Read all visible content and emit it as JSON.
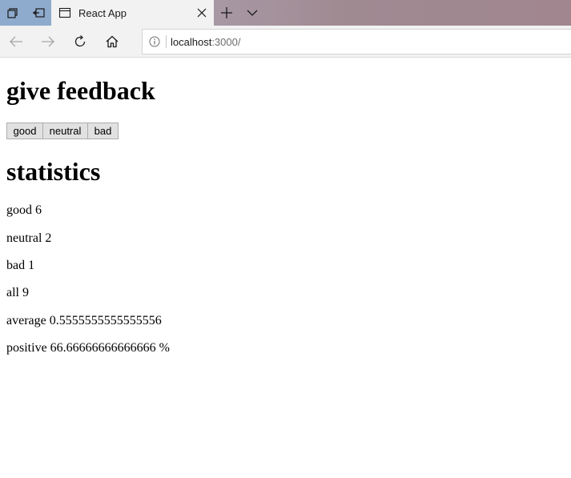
{
  "browser": {
    "tab": {
      "title": "React App"
    },
    "address": {
      "host": "localhost",
      "path": ":3000/"
    },
    "colors": {
      "tab_strip": "#a89aa6",
      "corner_buttons": "#8eaacc",
      "chrome": "#f2f2f2"
    }
  },
  "icons": {
    "tab_actions": "tab-actions-icon",
    "set_aside": "set-aside-tabs-icon",
    "page": "page-icon",
    "close": "close-icon",
    "new_tab": "plus-icon",
    "tab_list": "chevron-down-icon",
    "back": "arrow-left-icon",
    "forward": "arrow-right-icon",
    "refresh": "refresh-icon",
    "home": "home-icon",
    "site_info": "info-icon"
  },
  "page": {
    "feedback_heading": "give feedback",
    "buttons": {
      "good": "good",
      "neutral": "neutral",
      "bad": "bad"
    },
    "statistics_heading": "statistics",
    "stats": {
      "good": {
        "label": "good",
        "value": "6"
      },
      "neutral": {
        "label": "neutral",
        "value": "2"
      },
      "bad": {
        "label": "bad",
        "value": "1"
      },
      "all": {
        "label": "all",
        "value": "9"
      },
      "average": {
        "label": "average",
        "value": "0.5555555555555556"
      },
      "positive": {
        "label": "positive",
        "value": "66.66666666666666",
        "unit": "%"
      }
    }
  }
}
